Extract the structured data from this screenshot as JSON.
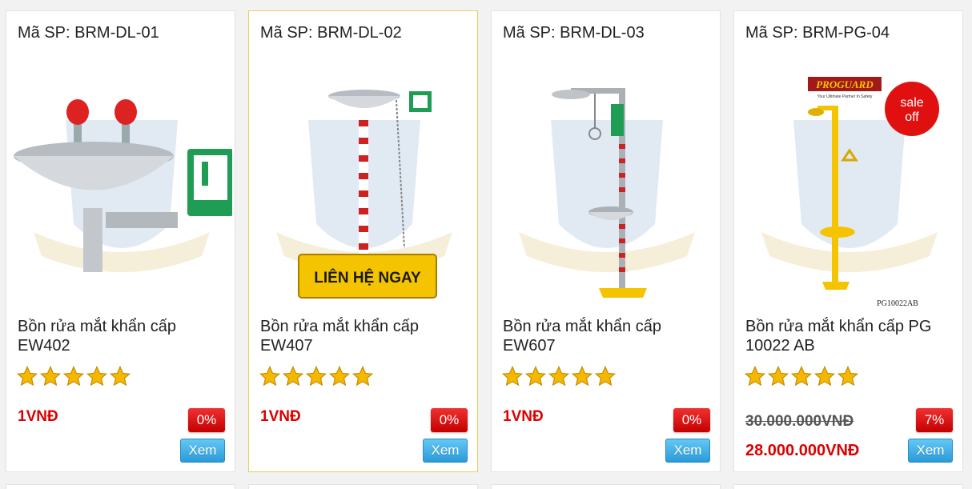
{
  "products": [
    {
      "sku_label": "Mã SP: BRM-DL-01",
      "name": "Bồn rửa mắt khẩn cấp EW402",
      "rating": 5,
      "price": "1VNĐ",
      "discount": "0%",
      "view_label": "Xem",
      "image_icon": "eye-wash-basin-image"
    },
    {
      "sku_label": "Mã SP: BRM-DL-02",
      "name": "Bồn rửa mắt khẩn cấp EW407",
      "rating": 5,
      "price": "1VNĐ",
      "discount": "0%",
      "view_label": "Xem",
      "contact_label": "LIÊN HỆ NGAY",
      "image_icon": "eye-wash-pedestal-image"
    },
    {
      "sku_label": "Mã SP: BRM-DL-03",
      "name": "Bồn rửa mắt khẩn cấp EW607",
      "rating": 5,
      "price": "1VNĐ",
      "discount": "0%",
      "view_label": "Xem",
      "image_icon": "eye-wash-shower-image"
    },
    {
      "sku_label": "Mã SP: BRM-PG-04",
      "name": "Bồn rửa mắt khẩn cấp PG 10022 AB",
      "rating": 5,
      "old_price": "30.000.000VNĐ",
      "new_price": "28.000.000VNĐ",
      "discount": "7%",
      "view_label": "Xem",
      "brand_logo": "PROGUARD",
      "brand_tagline": "Your Ultimate Partner In Safety",
      "sale_badge_line1": "sale",
      "sale_badge_line2": "off",
      "model_caption": "PG10022AB",
      "image_icon": "yellow-shower-station-image"
    }
  ],
  "colors": {
    "price_red": "#dd0000",
    "badge_red": "#d81f1f",
    "button_blue": "#2a9ad8",
    "active_border": "#e8cf5a",
    "star_gold": "#f5b800"
  }
}
